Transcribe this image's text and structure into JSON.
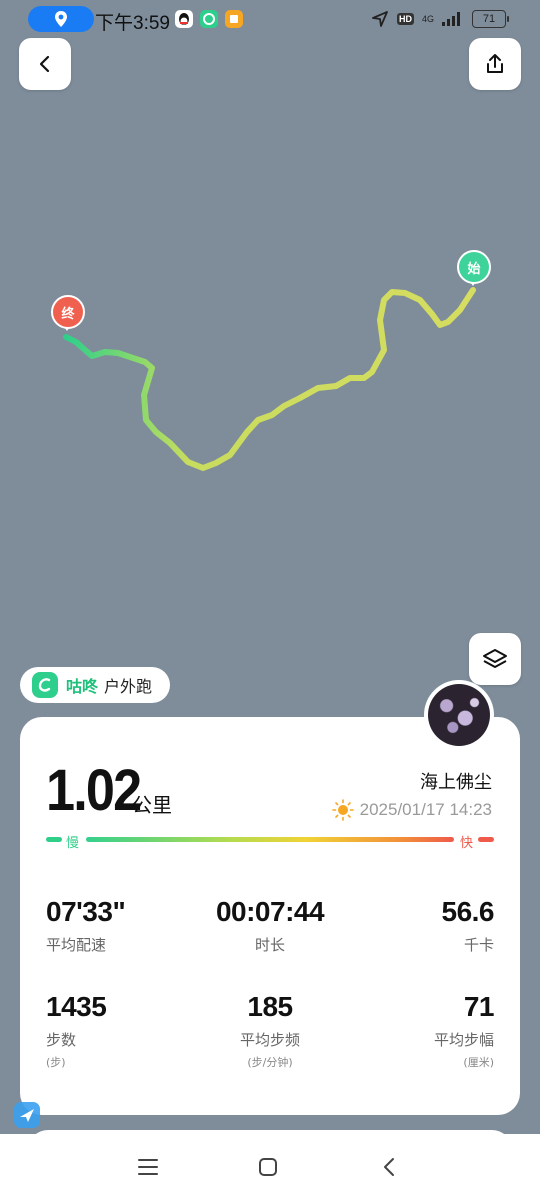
{
  "status_bar": {
    "time": "下午3:59",
    "hd": "HD",
    "network": "4G",
    "battery": "71"
  },
  "header": {
    "back": "back",
    "share": "share"
  },
  "map": {
    "start_label": "始",
    "end_label": "终",
    "start_color": "#3ed39a",
    "end_color": "#f0604f",
    "route_colors": [
      "#2fcf8a",
      "#cfdc5c"
    ]
  },
  "app_badge": {
    "name": "咕咚",
    "activity": "户外跑"
  },
  "summary": {
    "distance": "1.02",
    "distance_unit": "公里",
    "user_name": "海上佛尘",
    "date": "2025/01/17 14:23",
    "pace_slow": "慢",
    "pace_fast": "快"
  },
  "stats": [
    {
      "value": "07'33\"",
      "label": "平均配速",
      "unit": ""
    },
    {
      "value": "00:07:44",
      "label": "时长",
      "unit": ""
    },
    {
      "value": "56.6",
      "label": "千卡",
      "unit": ""
    },
    {
      "value": "1435",
      "label": "步数",
      "unit": "(步)"
    },
    {
      "value": "185",
      "label": "平均步频",
      "unit": "(步/分钟)"
    },
    {
      "value": "71",
      "label": "平均步幅",
      "unit": "(厘米)"
    }
  ]
}
